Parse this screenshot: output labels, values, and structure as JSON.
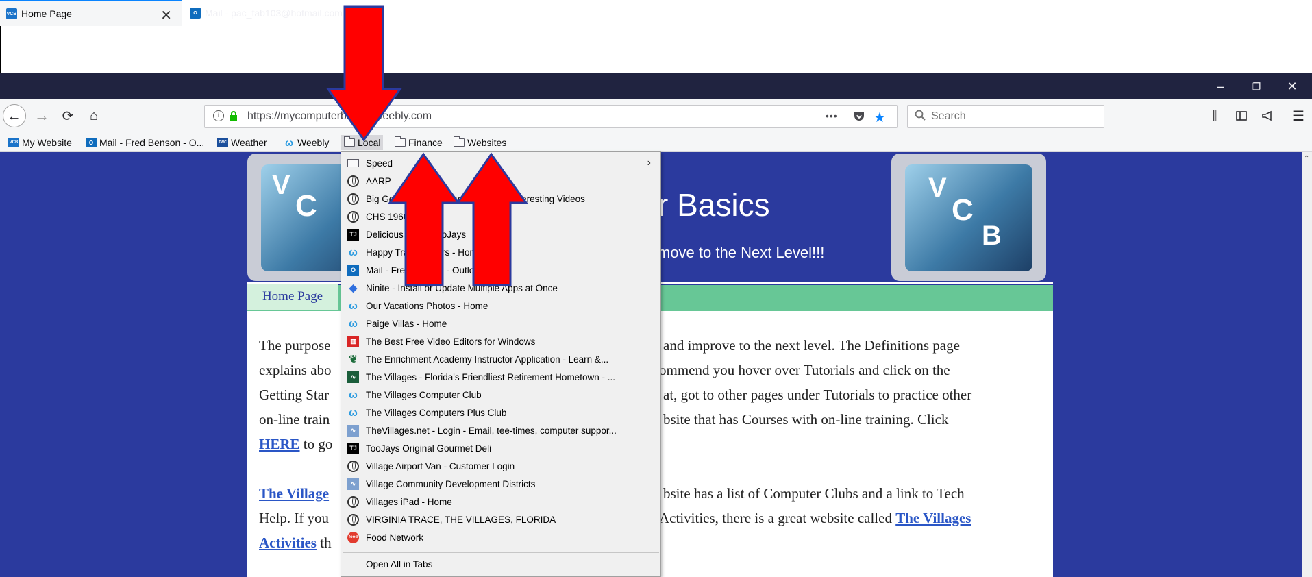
{
  "tabs": [
    {
      "label": "Home Page",
      "icon": "vcb-favicon",
      "active": true
    },
    {
      "label": "Mail - pac_fab103@hotmail.com",
      "icon": "outlook-favicon",
      "active": false
    }
  ],
  "new_tab_label": "+",
  "window_controls": {
    "minimize": "–",
    "restore": "❐",
    "close": "✕"
  },
  "navigation": {
    "url": "https://mycomputerbasics.weebly.com",
    "search_placeholder": "Search",
    "page_actions": "•••"
  },
  "bookmarks": [
    {
      "label": "My Website",
      "icon": "vcb-favicon"
    },
    {
      "label": "Mail - Fred Benson - O...",
      "icon": "outlook-icon"
    },
    {
      "label": "Weather",
      "icon": "weather-channel-icon"
    },
    {
      "label": "Weebly",
      "icon": "weebly-icon"
    },
    {
      "label": "Local",
      "icon": "folder-icon",
      "open": true
    },
    {
      "label": "Finance",
      "icon": "folder-icon"
    },
    {
      "label": "Websites",
      "icon": "folder-icon"
    }
  ],
  "local_menu": {
    "items": [
      {
        "label": "Speed",
        "icon": "folder-icon",
        "submenu": true
      },
      {
        "label": "AARP",
        "icon": "globe-icon"
      },
      {
        "label": "Big Geek Daddy - Funny, Cool and Interesting Videos",
        "icon": "globe-icon"
      },
      {
        "label": "CHS 1960",
        "icon": "globe-icon"
      },
      {
        "label": "Delicious Deals  TooJays",
        "icon": "toojays-icon"
      },
      {
        "label": "Happy Trail Dancers - Home",
        "icon": "weebly-icon"
      },
      {
        "label": "Mail - Fred Benson - Outlook",
        "icon": "outlook-icon"
      },
      {
        "label": "Ninite - Install or Update Multiple Apps at Once",
        "icon": "ninite-icon"
      },
      {
        "label": "Our Vacations Photos - Home",
        "icon": "weebly-icon"
      },
      {
        "label": "Paige Villas - Home",
        "icon": "weebly-icon"
      },
      {
        "label": "The Best Free Video Editors for Windows",
        "icon": "red-grid-icon"
      },
      {
        "label": "The Enrichment Academy  Instructor Application - Learn &...",
        "icon": "leaf-icon"
      },
      {
        "label": "The Villages - Florida's Friendliest Retirement Hometown - ...",
        "icon": "villages-icon"
      },
      {
        "label": "The Villages Computer Club",
        "icon": "weebly-icon"
      },
      {
        "label": "The Villages Computers Plus Club",
        "icon": "weebly-icon"
      },
      {
        "label": "TheVillages.net - Login - Email, tee-times, computer suppor...",
        "icon": "chart-icon"
      },
      {
        "label": "TooJays  Original Gourmet Deli",
        "icon": "toojays-icon"
      },
      {
        "label": "Village Airport Van - Customer Login",
        "icon": "globe-icon"
      },
      {
        "label": "Village Community Development Districts",
        "icon": "chart-icon"
      },
      {
        "label": "Villages iPad - Home",
        "icon": "globe-icon"
      },
      {
        "label": "VIRGINIA TRACE,  THE VILLAGES,  FLORIDA",
        "icon": "globe-icon"
      },
      {
        "label": "Food Network",
        "icon": "food-network-icon"
      }
    ],
    "open_all": "Open All in Tabs"
  },
  "website": {
    "logo_letters": [
      "V",
      "C",
      "B"
    ],
    "title": "r Basics",
    "subtitle": "move to the Next Level!!!",
    "nav_home": "Home Page",
    "paragraph_left": [
      "The purpose",
      "explains abo",
      "Getting Star",
      "on-line train"
    ],
    "paragraph_right": [
      "and improve to the next level.  The Definitions page",
      "ommend you hover over Tutorials and click on the",
      "at, got to other pages under Tutorials to practice other",
      "bsite that has Courses with on-line training.  Click"
    ],
    "here_link": "HERE",
    "here_suffix": " to go",
    "p2_left_link": "The Village",
    "p2_left_2": "Help.  If you",
    "p2_left_3_link": "Activities",
    "p2_left_3_suffix": " th",
    "p2_right_1": "bsite has a list of Computer Clubs and a link to Tech",
    "p2_right_2": "Activities, there is a great website called ",
    "p2_right_link": "The Villages"
  },
  "colors": {
    "tab_bar": "#202340",
    "page_background": "#2b3a9e",
    "site_nav": "#67c796",
    "annotation_arrow": "#ff0000"
  }
}
